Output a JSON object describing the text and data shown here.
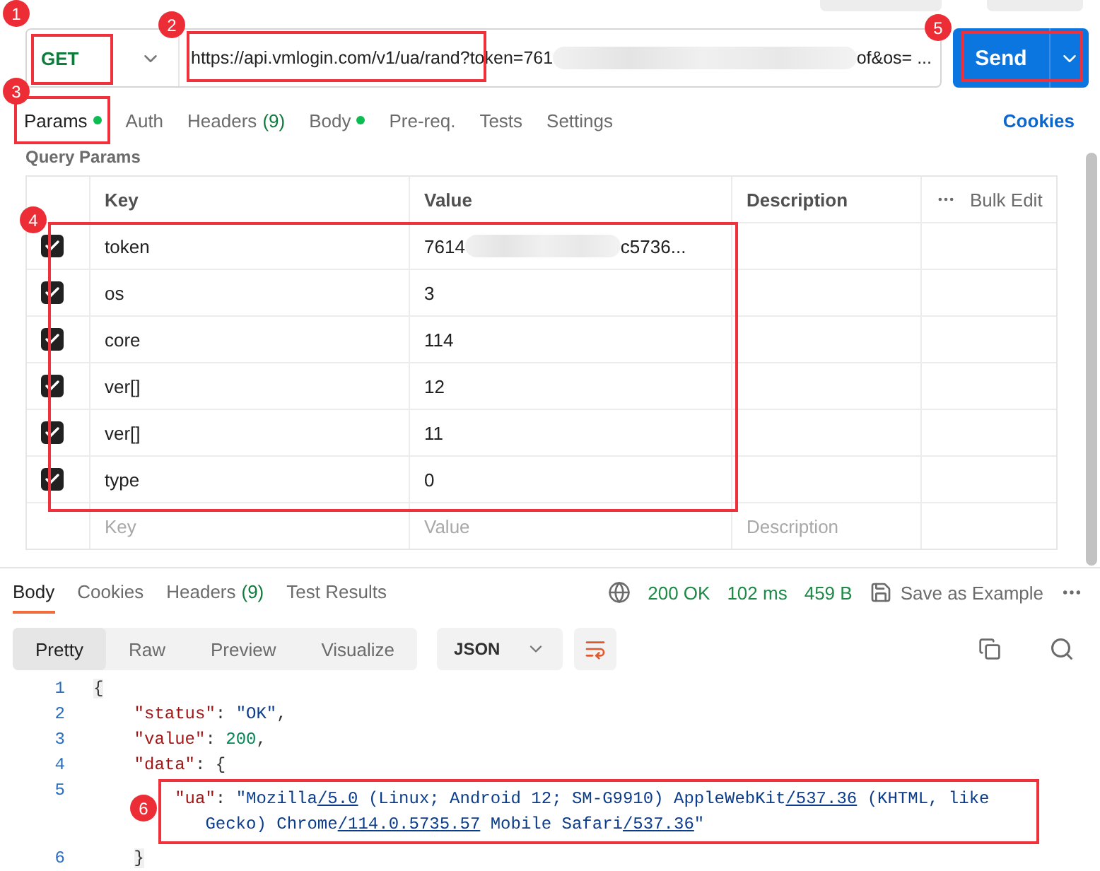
{
  "request": {
    "method": "GET",
    "url_start": "https://api.vmlogin.com/v1/ua/rand?token=761",
    "url_redacted": true,
    "url_end": "of&os= ...",
    "send": "Send"
  },
  "request_tabs": [
    {
      "label": "Params",
      "dot": true,
      "selected": true
    },
    {
      "label": "Auth",
      "dot": false,
      "selected": false
    },
    {
      "label": "Headers",
      "count": "(9)",
      "dot": false,
      "selected": false
    },
    {
      "label": "Body",
      "dot": true,
      "selected": false
    },
    {
      "label": "Pre-req.",
      "dot": false,
      "selected": false
    },
    {
      "label": "Tests",
      "dot": false,
      "selected": false
    },
    {
      "label": "Settings",
      "dot": false,
      "selected": false
    }
  ],
  "cookies_link": "Cookies",
  "query_params": {
    "title": "Query Params",
    "columns": [
      "Key",
      "Value",
      "Description"
    ],
    "bulk_edit": "Bulk Edit",
    "rows": [
      {
        "checked": true,
        "key": "token",
        "value": "7614",
        "redacted": true,
        "value_tail": "c5736..."
      },
      {
        "checked": true,
        "key": "os",
        "value": "3"
      },
      {
        "checked": true,
        "key": "core",
        "value": "114"
      },
      {
        "checked": true,
        "key": "ver[]",
        "value": "12"
      },
      {
        "checked": true,
        "key": "ver[]",
        "value": "11"
      },
      {
        "checked": true,
        "key": "type",
        "value": "0"
      }
    ],
    "new_row": {
      "key": {
        "placeholder": "Key"
      },
      "value": {
        "placeholder": "Value"
      },
      "description": {
        "placeholder": "Description"
      }
    }
  },
  "response": {
    "tabs": [
      {
        "label": "Body",
        "selected": true
      },
      {
        "label": "Cookies",
        "selected": false
      },
      {
        "label": "Headers",
        "count": "(9)",
        "selected": false
      },
      {
        "label": "Test Results",
        "selected": false
      }
    ],
    "status": "200 OK",
    "time": "102 ms",
    "size": "459 B",
    "save": "Save as Example",
    "views": [
      {
        "label": "Pretty",
        "selected": true
      },
      {
        "label": "Raw",
        "selected": false
      },
      {
        "label": "Preview",
        "selected": false
      },
      {
        "label": "Visualize",
        "selected": false
      }
    ],
    "format": "JSON",
    "lines": [
      {
        "number": "1",
        "segments": [
          {
            "kind": "bracket",
            "text": "{"
          }
        ],
        "children": [
          {
            "number": "2",
            "segments": [
              {
                "kind": "key",
                "text": "\"status\""
              },
              {
                "kind": "punct",
                "text": ": "
              },
              {
                "kind": "string",
                "text": "\"OK\""
              },
              {
                "kind": "punct",
                "text": ","
              }
            ]
          },
          {
            "number": "3",
            "segments": [
              {
                "kind": "key",
                "text": "\"value\""
              },
              {
                "kind": "punct",
                "text": ": "
              },
              {
                "kind": "number",
                "text": "200"
              },
              {
                "kind": "punct",
                "text": ","
              }
            ]
          },
          {
            "number": "4",
            "segments": [
              {
                "kind": "key",
                "text": "\"data\""
              },
              {
                "kind": "punct",
                "text": ": {"
              }
            ],
            "children": [
              {
                "number": "5",
                "segments": [
                  {
                    "kind": "key",
                    "text": "\"ua\""
                  },
                  {
                    "kind": "punct",
                    "text": ": "
                  },
                  {
                    "kind": "string",
                    "text": "\"Mozilla"
                  },
                  {
                    "kind": "link",
                    "text": "/5.0"
                  },
                  {
                    "kind": "string",
                    "text": " (Linux; Android 12; SM-G9910) AppleWebKit"
                  },
                  {
                    "kind": "link",
                    "text": "/537.36"
                  },
                  {
                    "kind": "string",
                    "text": " (KHTML, like Gecko) Chrome"
                  },
                  {
                    "kind": "link",
                    "text": "/114.0.5735.57"
                  },
                  {
                    "kind": "string",
                    "text": " Mobile Safari"
                  },
                  {
                    "kind": "link",
                    "text": "/537.36"
                  },
                  {
                    "kind": "string",
                    "text": "\""
                  }
                ]
              }
            ]
          },
          {
            "number": "6",
            "segments": [
              {
                "kind": "bracket",
                "text": "}"
              }
            ]
          }
        ]
      }
    ]
  },
  "annotations": [
    {
      "number": "1"
    },
    {
      "number": "2"
    },
    {
      "number": "3"
    },
    {
      "number": "4"
    },
    {
      "number": "5"
    },
    {
      "number": "6"
    }
  ]
}
